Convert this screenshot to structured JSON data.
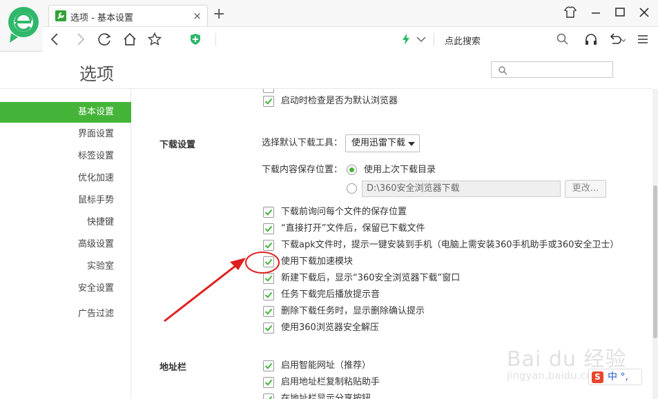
{
  "browser": {
    "tab_title": "选项 - 基本设置",
    "tab_close": "×",
    "new_tab": "+",
    "search_placeholder": "点此搜索"
  },
  "options": {
    "title": "选项"
  },
  "sidebar": {
    "items": [
      {
        "label": "基本设置",
        "active": true
      },
      {
        "label": "界面设置"
      },
      {
        "label": "标签设置"
      },
      {
        "label": "优化加速"
      },
      {
        "label": "鼠标手势"
      },
      {
        "label": "快捷键"
      },
      {
        "label": "高级设置"
      },
      {
        "label": "实验室"
      },
      {
        "label": "安全设置"
      },
      {
        "label": "广告过滤"
      }
    ]
  },
  "startup": {
    "check_default": "启动时检查是否为默认浏览器"
  },
  "download": {
    "section_title": "下载设置",
    "tool_label": "选择默认下载工具：",
    "tool_value": "使用迅雷下载",
    "location_label": "下载内容保存位置：",
    "location_last": "使用上次下载目录",
    "path_value": "D:\\360安全浏览器下载",
    "change_button": "更改...",
    "options": [
      "下载前询问每个文件的保存位置",
      "“直接打开”文件后，保留已下载文件",
      "下载apk文件时，提示一键安装到手机（电脑上需安装360手机助手或360安全卫士）",
      "使用下载加速模块",
      "新建下载后，显示“360安全浏览器下载”窗口",
      "任务下载完后播放提示音",
      "删除下载任务时，显示删除确认提示",
      "使用360浏览器安全解压"
    ]
  },
  "addressbar": {
    "section_title": "地址栏",
    "options": [
      "启用智能网址（推荐）",
      "启用地址栏复制粘贴助手",
      "在地址栏显示分享按钮"
    ]
  },
  "watermark": {
    "brand": "Bai du 经验",
    "url": "jingyan.baidu.com"
  },
  "ime": {
    "icon": "S",
    "text": "中 °,"
  },
  "colors": {
    "accent": "#43b437",
    "annotation": "#e02020"
  }
}
